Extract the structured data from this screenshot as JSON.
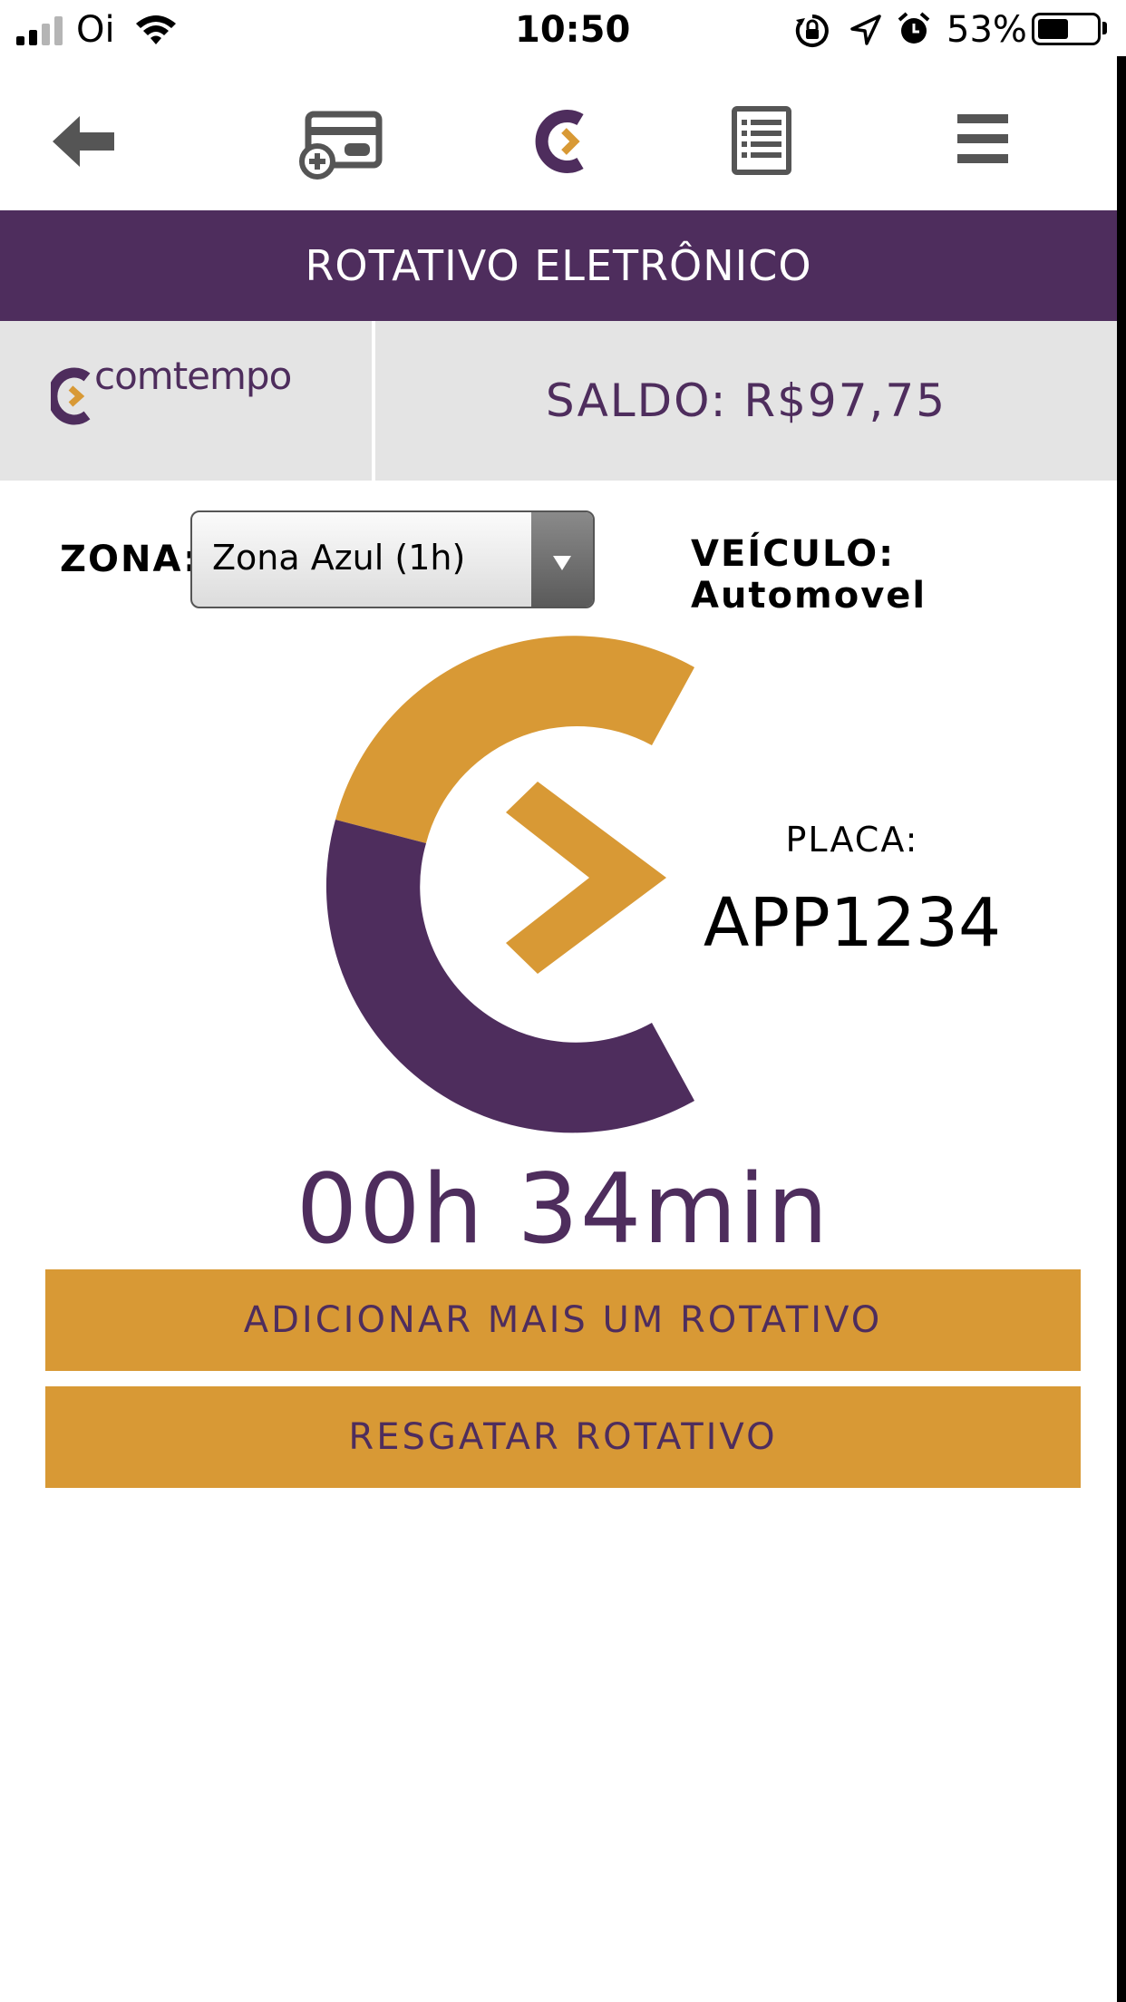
{
  "status_bar": {
    "carrier": "Oi",
    "time": "10:50",
    "battery_percent": "53%",
    "battery_level": 0.53,
    "icons": [
      "signal-icon",
      "wifi-icon",
      "orientation-lock-icon",
      "location-icon",
      "alarm-icon",
      "battery-icon"
    ]
  },
  "toolbar": {
    "icons": [
      "back-arrow-icon",
      "add-card-icon",
      "comtempo-logo-icon",
      "list-icon",
      "menu-icon"
    ]
  },
  "header": {
    "title": "ROTATIVO ELETRÔNICO"
  },
  "account": {
    "brand": "comtempo",
    "balance": "SALDO: R$97,75"
  },
  "parking": {
    "zone_label": "ZONA:",
    "zone_value": "Zona Azul (1h)",
    "vehicle": "VEÍCULO: Automovel",
    "plate_label": "PLACA:",
    "plate_value": "APP1234",
    "remaining_time": "00h 34min"
  },
  "actions": {
    "add_label": "ADICIONAR MAIS UM ROTATIVO",
    "redeem_label": "RESGATAR ROTATIVO"
  },
  "colors": {
    "purple": "#4e2d5d",
    "gold": "#d89935",
    "gray_bar": "#e4e4e4"
  }
}
